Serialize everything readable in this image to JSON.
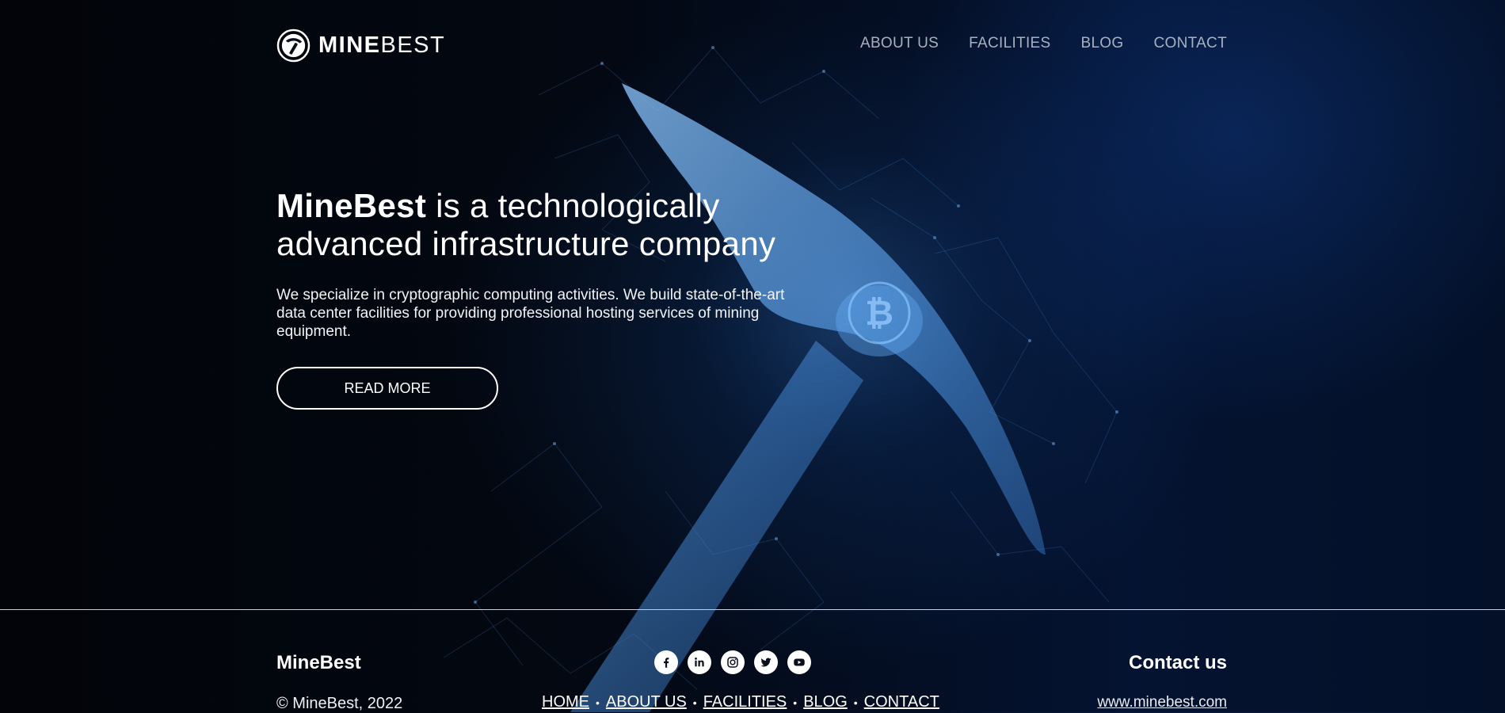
{
  "header": {
    "logo": {
      "strong": "MINE",
      "light": "BEST",
      "icon": "pickaxe-circle-icon"
    },
    "nav": [
      {
        "label": "ABOUT US"
      },
      {
        "label": "FACILITIES"
      },
      {
        "label": "BLOG"
      },
      {
        "label": "CONTACT"
      }
    ]
  },
  "hero": {
    "headline_brand": "MineBest",
    "headline_rest": " is a technologically advanced infrastructure company",
    "description": "We specialize in cryptographic computing activities. We build state-of-the-art data center facilities for providing professional hosting services of mining equipment.",
    "button_label": "READ MORE"
  },
  "footer": {
    "brand": "MineBest",
    "copyright": "© MineBest, 2022",
    "socials": [
      "facebook-icon",
      "linkedin-icon",
      "instagram-icon",
      "twitter-icon",
      "youtube-icon"
    ],
    "links": [
      {
        "label": "HOME"
      },
      {
        "label": "ABOUT US"
      },
      {
        "label": "FACILITIES"
      },
      {
        "label": "BLOG"
      },
      {
        "label": "CONTACT"
      }
    ],
    "contact_title": "Contact us",
    "website": "www.minebest.com"
  },
  "colors": {
    "background": "#020409",
    "accent_blue": "#4a90d9",
    "nav_text": "#a7b0bf",
    "text": "#ffffff"
  }
}
